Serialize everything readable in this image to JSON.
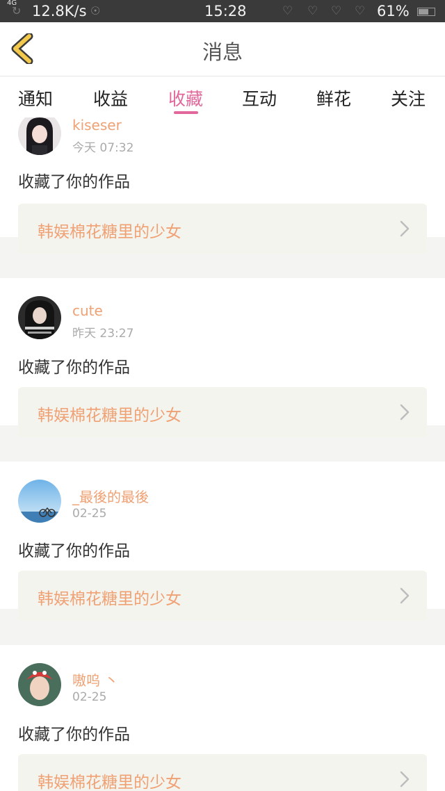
{
  "status_bar": {
    "network_type": "4G",
    "speed": "12.8K/s",
    "time": "15:28",
    "battery_percent": "61%",
    "icons": [
      "signal-icon",
      "wifi-icon",
      "heart-icon",
      "battery-icon"
    ]
  },
  "header": {
    "title": "消息",
    "back_icon": "back-chevron-icon",
    "accent_color": "#f2c94c"
  },
  "tabs": {
    "items": [
      {
        "label": "通知"
      },
      {
        "label": "收益"
      },
      {
        "label": "收藏"
      },
      {
        "label": "互动"
      },
      {
        "label": "鲜花"
      },
      {
        "label": "关注"
      }
    ],
    "active_index": 2,
    "active_color": "#e2679a"
  },
  "messages": [
    {
      "username": "kiseser",
      "time": "今天 07:32",
      "action": "收藏了你的作品",
      "work_title": "韩娱棉花糖里的少女"
    },
    {
      "username": "cute",
      "time": "昨天 23:27",
      "action": "收藏了你的作品",
      "work_title": "韩娱棉花糖里的少女"
    },
    {
      "username": "_最後的最後",
      "time": "02-25",
      "action": "收藏了你的作品",
      "work_title": "韩娱棉花糖里的少女"
    },
    {
      "username": "嗷呜 丶",
      "time": "02-25",
      "action": "收藏了你的作品",
      "work_title": "韩娱棉花糖里的少女"
    }
  ],
  "colors": {
    "name_color": "#f0a174",
    "card_box_bg": "#f4f4ee"
  }
}
